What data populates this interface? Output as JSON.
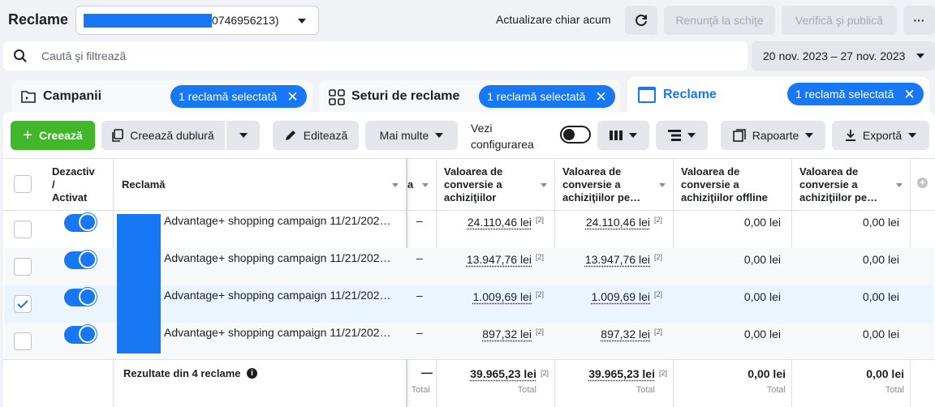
{
  "header": {
    "title": "Reclame",
    "account_suffix": "0746956213)",
    "update_label": "Actualizare chiar acum",
    "discard_label": "Renunţă la schiţe",
    "review_publish_label": "Verifică şi publică",
    "more_label": "···"
  },
  "search": {
    "placeholder": "Caută şi filtrează",
    "date_range": "20 nov. 2023 – 27 nov. 2023"
  },
  "tabs": [
    {
      "label": "Campanii",
      "chip": "1 reclamă selectată"
    },
    {
      "label": "Seturi de reclame",
      "chip": "1 reclamă selectată"
    },
    {
      "label": "Reclame",
      "chip": "1 reclamă selectată"
    }
  ],
  "toolbar": {
    "create": "Creează",
    "duplicate": "Creează dublură",
    "edit": "Editează",
    "more": "Mai multe",
    "view_setup_1": "Vezi",
    "view_setup_2": "configurarea",
    "reports": "Rapoarte",
    "export": "Exportă"
  },
  "table": {
    "headers": {
      "toggle_1": "Dezactiv",
      "toggle_2": "/",
      "toggle_3": "Activat",
      "ad": "Reclamă",
      "partial": "a",
      "col1": [
        "Valoarea de",
        "conversie a",
        "achiziţiilor"
      ],
      "col2": [
        "Valoarea de",
        "conversie a",
        "achiziţiilor pe…"
      ],
      "col3": [
        "Valoarea de",
        "conversie a",
        "achiziţiilor offline"
      ],
      "col4": [
        "Valoarea de",
        "conversie a",
        "achiziţiilor pe…"
      ]
    },
    "rows": [
      {
        "name": "Advantage+ shopping campaign 11/21/202…",
        "dash": "–",
        "v1": "24.110,46 lei",
        "s1": "[2]",
        "v2": "24.110,46 lei",
        "s2": "[2]",
        "v3": "0,00 lei",
        "v4": "0,00 lei",
        "checked": false
      },
      {
        "name": "Advantage+ shopping campaign 11/21/202…",
        "dash": "–",
        "v1": "13.947,76 lei",
        "s1": "[2]",
        "v2": "13.947,76 lei",
        "s2": "[2]",
        "v3": "0,00 lei",
        "v4": "0,00 lei",
        "checked": false
      },
      {
        "name": "Advantage+ shopping campaign 11/21/202…",
        "dash": "–",
        "v1": "1.009,69 lei",
        "s1": "[2]",
        "v2": "1.009,69 lei",
        "s2": "[2]",
        "v3": "0,00 lei",
        "v4": "0,00 lei",
        "checked": true
      },
      {
        "name": "Advantage+ shopping campaign 11/21/202…",
        "dash": "–",
        "v1": "897,32 lei",
        "s1": "[2]",
        "v2": "897,32 lei",
        "s2": "[2]",
        "v3": "0,00 lei",
        "v4": "0,00 lei",
        "checked": false
      }
    ],
    "summary": {
      "label": "Rezultate din 4 reclame",
      "dash": "—",
      "v1": "39.965,23 lei",
      "s1": "[2]",
      "v2": "39.965,23 lei",
      "s2": "[2]",
      "v3": "0,00 lei",
      "v4": "0,00 lei",
      "total": "Total"
    }
  },
  "colors": {
    "accent": "#1877f2",
    "create": "#42b72a"
  }
}
